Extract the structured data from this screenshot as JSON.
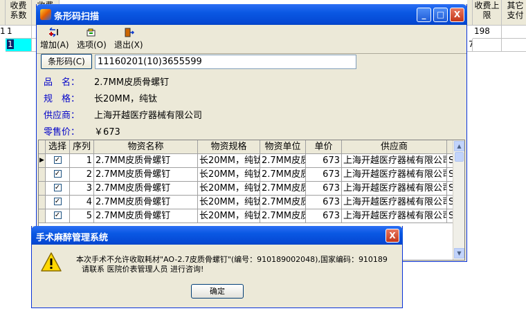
{
  "background_table": {
    "headers": [
      "收费系数",
      "收费",
      "收费",
      "收费上限",
      "其它支付"
    ],
    "rows": [
      {
        "c1": "1",
        "c2": "",
        "right": "198",
        "tail": ""
      },
      {
        "c1": "1",
        "c2": "",
        "right": "",
        "tail": "75"
      }
    ],
    "edge_char": "1"
  },
  "scanner": {
    "title": "条形码扫描",
    "window_buttons": {
      "minimize": "_",
      "maximize": "□",
      "close": "X"
    },
    "toolbar": {
      "add": "增加(A)",
      "options": "选项(O)",
      "exit": "退出(X)"
    },
    "barcode_label": "条形码(C)",
    "barcode_value": "11160201(10)3655599",
    "fields": {
      "name_label": "品　名：",
      "name_value": "2.7MM皮质骨螺钉",
      "spec_label": "规　格：",
      "spec_value": "长20MM，纯钛",
      "supplier_label": "供应商：",
      "supplier_value": "上海开越医疗器械有限公司",
      "price_label": "零售价：",
      "price_value": "￥673"
    },
    "grid": {
      "headers": [
        "选择",
        "序列",
        "物资名称",
        "物资规格",
        "物资单位",
        "单价",
        "供应商"
      ],
      "rows": [
        {
          "seq": "1",
          "name": "2.7MM皮质骨螺钉",
          "spec": "长20MM，纯钛",
          "unit": "2.7MM皮质",
          "price": "673",
          "supplier": "上海开越医疗器械有限公司",
          "extra": "S"
        },
        {
          "seq": "2",
          "name": "2.7MM皮质骨螺钉",
          "spec": "长20MM，纯钛",
          "unit": "2.7MM皮质",
          "price": "673",
          "supplier": "上海开越医疗器械有限公司",
          "extra": "S"
        },
        {
          "seq": "3",
          "name": "2.7MM皮质骨螺钉",
          "spec": "长20MM，纯钛",
          "unit": "2.7MM皮质",
          "price": "673",
          "supplier": "上海开越医疗器械有限公司",
          "extra": "S"
        },
        {
          "seq": "4",
          "name": "2.7MM皮质骨螺钉",
          "spec": "长20MM，纯钛",
          "unit": "2.7MM皮质",
          "price": "673",
          "supplier": "上海开越医疗器械有限公司",
          "extra": "S"
        },
        {
          "seq": "5",
          "name": "2.7MM皮质骨螺钉",
          "spec": "长20MM，纯钛",
          "unit": "2.7MM皮质",
          "price": "673",
          "supplier": "上海开越医疗器械有限公司",
          "extra": "S"
        }
      ]
    }
  },
  "dialog": {
    "title": "手术麻醉管理系统",
    "close": "X",
    "line1": "本次手术不允许收取耗材\"AO-2.7皮质骨螺钉\"(编号：910189002048),国家编码：910189",
    "line2": "请联系 医院价表管理人员 进行咨询!",
    "ok": "确定",
    "icon": "warning-icon"
  },
  "colors": {
    "title_blue": "#0548d4",
    "label_blue": "#0000c8",
    "selected_cyan": "#00ffff"
  }
}
